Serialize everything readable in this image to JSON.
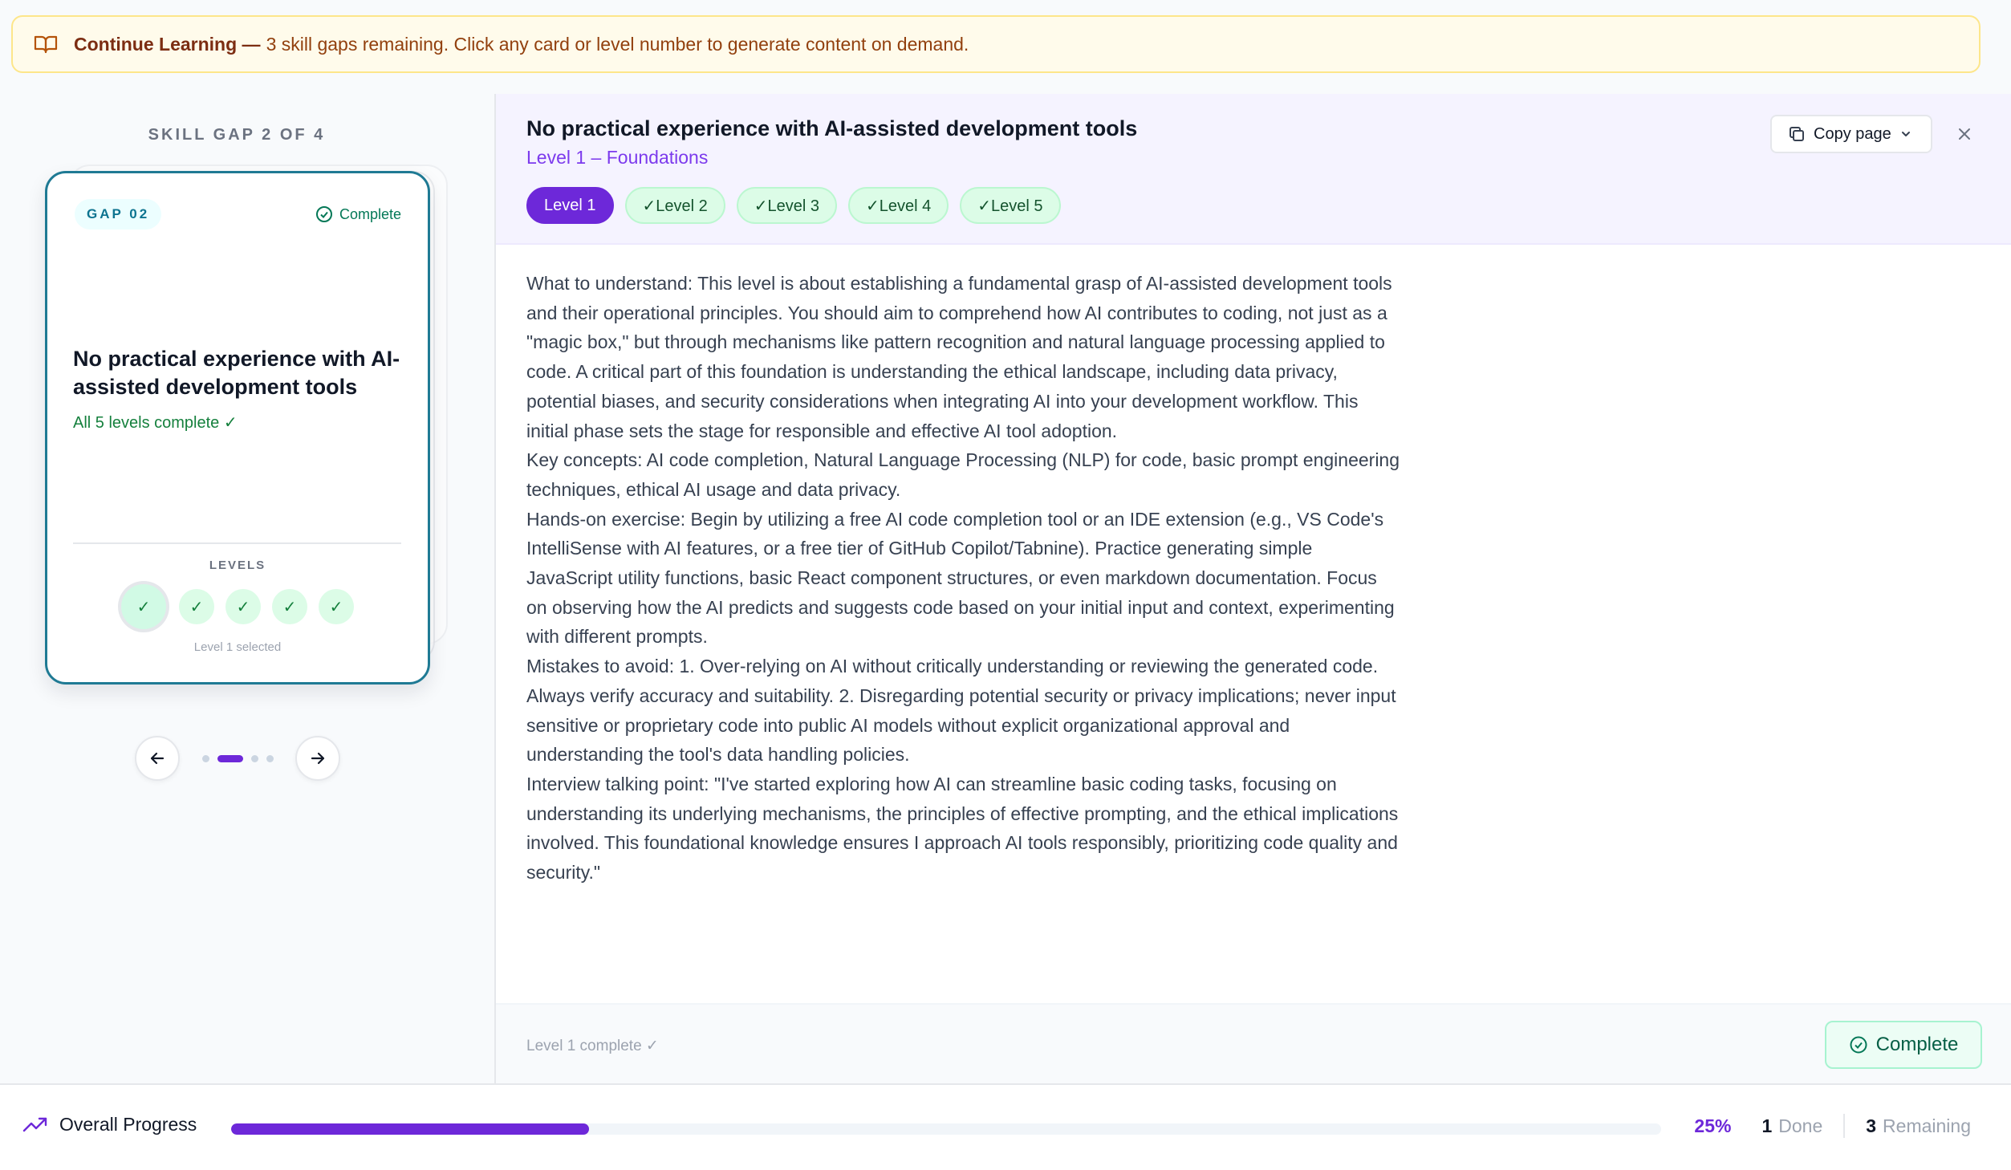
{
  "banner": {
    "title": "Continue Learning —",
    "message": "3 skill gaps remaining. Click any card or level number to generate content on demand."
  },
  "sidebar": {
    "counter": "SKILL GAP 2 OF 4",
    "card": {
      "badge": "GAP 02",
      "status": "Complete",
      "title": "No practical experience with AI-assisted development tools",
      "subtitle": "All 5 levels complete ✓",
      "levels_label": "LEVELS",
      "level_marks": [
        "✓",
        "✓",
        "✓",
        "✓",
        "✓"
      ],
      "selected_note": "Level 1 selected"
    }
  },
  "panel": {
    "title": "No practical experience with AI-assisted development tools",
    "subtitle": "Level 1 – Foundations",
    "tabs": [
      {
        "label": "Level 1"
      },
      {
        "label": "✓Level 2"
      },
      {
        "label": "✓Level 3"
      },
      {
        "label": "✓Level 4"
      },
      {
        "label": "✓Level 5"
      }
    ],
    "copy_label": "Copy page",
    "body": [
      "What to understand: This level is about establishing a fundamental grasp of AI-assisted development tools and their operational principles. You should aim to comprehend how AI contributes to coding, not just as a \"magic box,\" but through mechanisms like pattern recognition and natural language processing applied to code. A critical part of this foundation is understanding the ethical landscape, including data privacy, potential biases, and security considerations when integrating AI into your development workflow. This initial phase sets the stage for responsible and effective AI tool adoption.",
      "Key concepts: AI code completion, Natural Language Processing (NLP) for code, basic prompt engineering techniques, ethical AI usage and data privacy.",
      "Hands-on exercise: Begin by utilizing a free AI code completion tool or an IDE extension (e.g., VS Code's IntelliSense with AI features, or a free tier of GitHub Copilot/Tabnine). Practice generating simple JavaScript utility functions, basic React component structures, or even markdown documentation. Focus on observing how the AI predicts and suggests code based on your initial input and context, experimenting with different prompts.",
      "Mistakes to avoid: 1. Over-relying on AI without critically understanding or reviewing the generated code. Always verify accuracy and suitability. 2. Disregarding potential security or privacy implications; never input sensitive or proprietary code into public AI models without explicit organizational approval and understanding the tool's data handling policies.",
      "Interview talking point: \"I've started exploring how AI can streamline basic coding tasks, focusing on understanding its underlying mechanisms, the principles of effective prompting, and the ethical implications involved. This foundational knowledge ensures I approach AI tools responsibly, prioritizing code quality and security.\""
    ],
    "footer_note": "Level 1 complete ✓",
    "complete_label": "Complete"
  },
  "progress": {
    "label": "Overall Progress",
    "percent_value": 25,
    "percent_text": "25%",
    "done_count": "1",
    "done_label": "Done",
    "remaining_count": "3",
    "remaining_label": "Remaining"
  },
  "colors": {
    "accent": "#6d28d9",
    "success": "#15803d",
    "card_border": "#1f7a94",
    "banner_bg": "#fffbeb"
  }
}
